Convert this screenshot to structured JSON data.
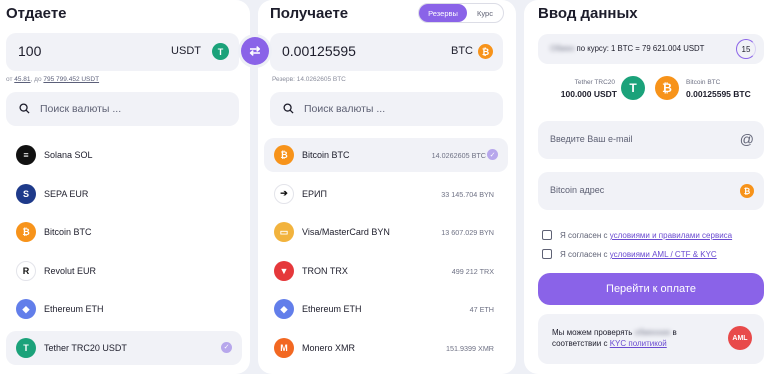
{
  "give": {
    "title": "Отдаете",
    "amount": "100",
    "currency": "USDT",
    "limits_from": "от",
    "limits_min": "45.81",
    "limits_to": "до",
    "limits_max": "795 799.452 USDT",
    "search_placeholder": "Поиск валюты ...",
    "items": [
      {
        "label": "Solana SOL",
        "icon": "solana-icon",
        "color": "#111111",
        "glyph": "≡"
      },
      {
        "label": "SEPA EUR",
        "icon": "sepa-icon",
        "color": "#1e3a8a",
        "glyph": "S"
      },
      {
        "label": "Bitcoin BTC",
        "icon": "bitcoin-icon",
        "color": "#f7931a",
        "glyph": "₿"
      },
      {
        "label": "Revolut EUR",
        "icon": "revolut-icon",
        "color": "#ffffff",
        "glyph": "R"
      },
      {
        "label": "Ethereum ETH",
        "icon": "ethereum-icon",
        "color": "#627eea",
        "glyph": "◆"
      },
      {
        "label": "Tether TRC20 USDT",
        "icon": "tether-icon",
        "color": "#1ba27a",
        "glyph": "T",
        "active": true
      }
    ]
  },
  "swap_icon": "swap-arrows-icon",
  "get": {
    "title": "Получаете",
    "toggle_reserves": "Резервы",
    "toggle_rate": "Курс",
    "amount": "0.00125595",
    "currency": "BTC",
    "reserve_note": "Резерв: 14.0262605 BTC",
    "search_placeholder": "Поиск валюты ...",
    "items": [
      {
        "label": "Bitcoin BTC",
        "reserve": "14.0262605 BTC",
        "icon": "bitcoin-icon",
        "color": "#f7931a",
        "glyph": "₿",
        "active": true
      },
      {
        "label": "ЕРИП",
        "reserve": "33 145.704 BYN",
        "icon": "erip-icon",
        "color": "#ffffff",
        "glyph": "➔"
      },
      {
        "label": "Visa/MasterCard BYN",
        "reserve": "13 607.029 BYN",
        "icon": "card-icon",
        "color": "#f2b33d",
        "glyph": "▭"
      },
      {
        "label": "TRON TRX",
        "reserve": "499 212 TRX",
        "icon": "tron-icon",
        "color": "#e5383b",
        "glyph": "▼"
      },
      {
        "label": "Ethereum ETH",
        "reserve": "47 ETH",
        "icon": "ethereum-icon",
        "color": "#627eea",
        "glyph": "◆"
      },
      {
        "label": "Monero XMR",
        "reserve": "151.9399 XMR",
        "icon": "monero-icon",
        "color": "#f26822",
        "glyph": "M"
      }
    ]
  },
  "form": {
    "title": "Ввод данных",
    "rate_blurred": "Обмен",
    "rate_text": "по курсу: 1 BTC = 79 621.004 USDT",
    "timer": "15",
    "from_label": "Tether TRC20",
    "from_value": "100.000 USDT",
    "to_label": "Bitcoin BTC",
    "to_value": "0.00125595 BTC",
    "email_placeholder": "Введите Ваш e-mail",
    "btc_placeholder": "Bitcoin адрес",
    "agree_prefix": "Я согласен с",
    "agree_rules": "условиями и правилами сервиса",
    "agree_aml": "условиями AML / CTF & KYC",
    "pay_button": "Перейти к оплате",
    "kyc_line1_a": "Мы можем проверять",
    "kyc_blurred": "обменник",
    "kyc_line1_b": "в",
    "kyc_line2": "соответствии с",
    "kyc_link": "KYC политикой",
    "aml_badge": "AML"
  },
  "colors": {
    "accent": "#8a63e8",
    "tether": "#1ba27a",
    "bitcoin": "#f7931a"
  }
}
